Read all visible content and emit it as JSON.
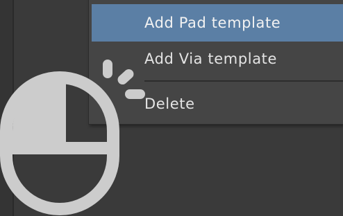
{
  "context_menu": {
    "items": [
      {
        "label": "Add Pad template",
        "highlighted": true
      },
      {
        "label": "Add Via template",
        "highlighted": false
      },
      {
        "label": "Delete",
        "highlighted": false
      }
    ]
  },
  "overlay": {
    "icon": "mouse-left-click-icon"
  },
  "colors": {
    "background": "#3a3a3a",
    "menu_background": "#454545",
    "highlight": "#5b7fa5",
    "menu_text": "#e4e4e4",
    "mouse_icon": "#cccccc"
  }
}
